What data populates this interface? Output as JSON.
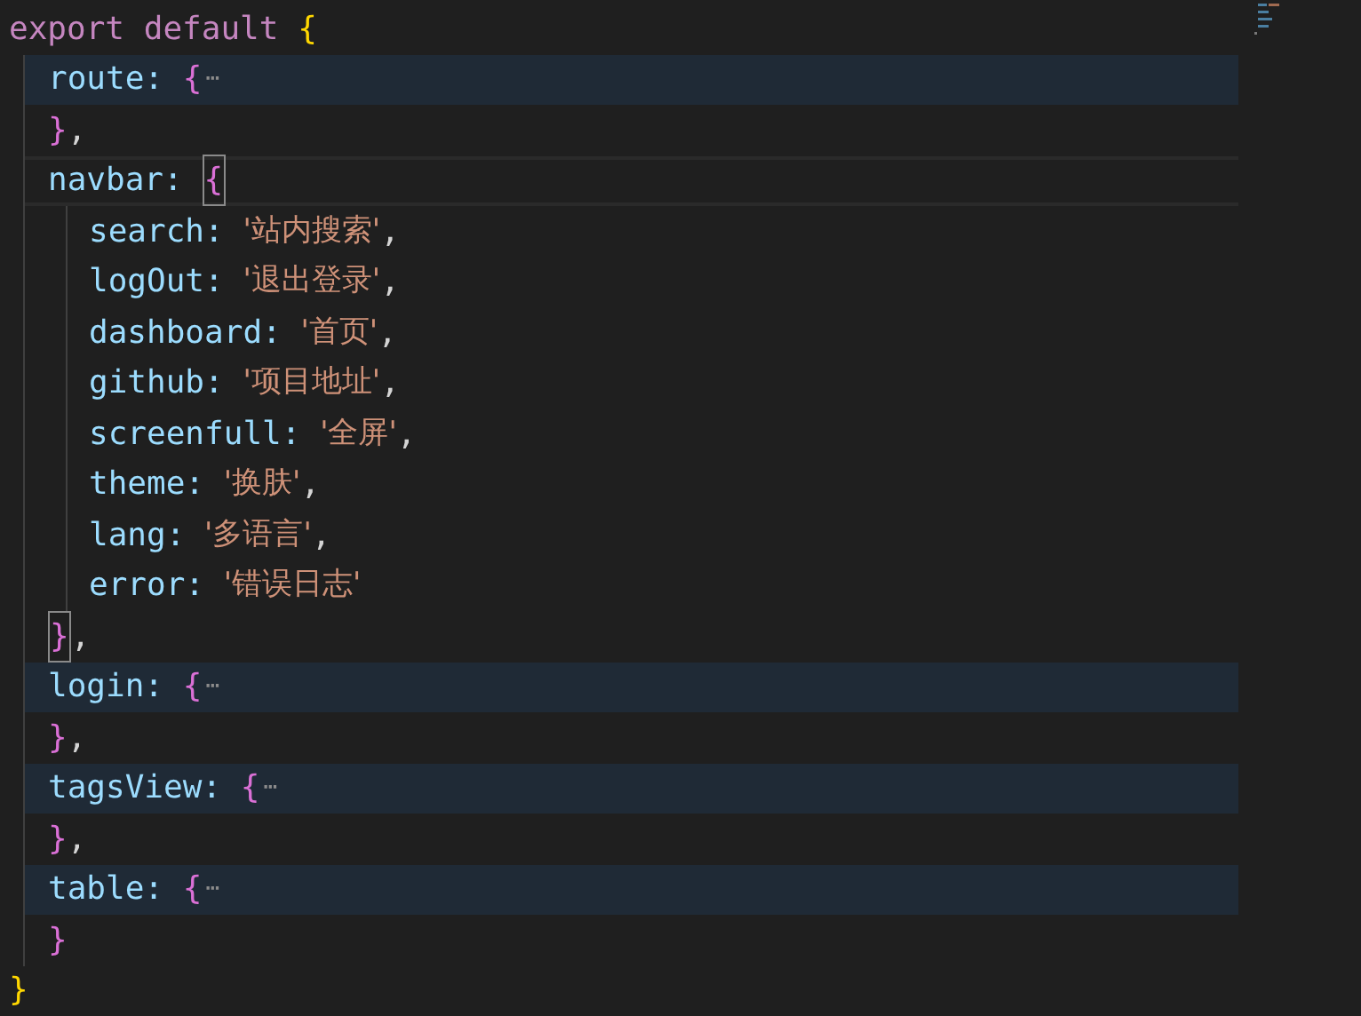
{
  "editor": {
    "root": {
      "keyword": "export default",
      "brace": "{",
      "close": "}",
      "members": [
        {
          "kind": "object",
          "key": "route:",
          "brace": "{",
          "folded": true,
          "ellipsis": "⋯",
          "close": "},",
          "bracket_matched": false,
          "current_line": false
        },
        {
          "kind": "object",
          "key": "navbar:",
          "brace": "{",
          "folded": false,
          "close": "},",
          "bracket_matched": true,
          "current_line": true,
          "children": [
            {
              "kind": "entry",
              "key": "search:",
              "value": "'站内搜索'",
              "comma": ","
            },
            {
              "kind": "entry",
              "key": "logOut:",
              "value": "'退出登录'",
              "comma": ","
            },
            {
              "kind": "entry",
              "key": "dashboard:",
              "value": "'首页'",
              "comma": ","
            },
            {
              "kind": "entry",
              "key": "github:",
              "value": "'项目地址'",
              "comma": ","
            },
            {
              "kind": "entry",
              "key": "screenfull:",
              "value": "'全屏'",
              "comma": ","
            },
            {
              "kind": "entry",
              "key": "theme:",
              "value": "'换肤'",
              "comma": ","
            },
            {
              "kind": "entry",
              "key": "lang:",
              "value": "'多语言'",
              "comma": ","
            },
            {
              "kind": "entry",
              "key": "error:",
              "value": "'错误日志'"
            }
          ]
        },
        {
          "kind": "object",
          "key": "login:",
          "brace": "{",
          "folded": true,
          "ellipsis": "⋯",
          "close": "},",
          "bracket_matched": false,
          "current_line": false
        },
        {
          "kind": "object",
          "key": "tagsView:",
          "brace": "{",
          "folded": true,
          "ellipsis": "⋯",
          "close": "},",
          "bracket_matched": false,
          "current_line": false
        },
        {
          "kind": "object",
          "key": "table:",
          "brace": "{",
          "folded": true,
          "ellipsis": "⋯",
          "close": "}",
          "bracket_matched": false,
          "current_line": false
        }
      ]
    }
  }
}
